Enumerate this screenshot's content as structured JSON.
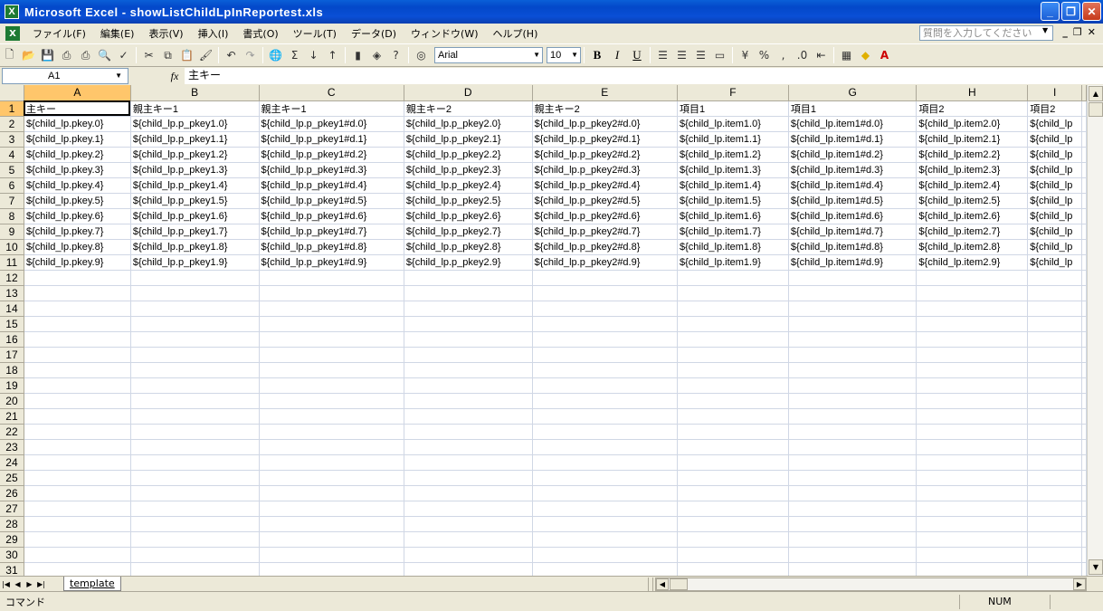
{
  "window": {
    "title": "Microsoft Excel - showListChildLpInReportest.xls",
    "app_icon": "X"
  },
  "menu": {
    "items": [
      "ファイル(F)",
      "編集(E)",
      "表示(V)",
      "挿入(I)",
      "書式(O)",
      "ツール(T)",
      "データ(D)",
      "ウィンドウ(W)",
      "ヘルプ(H)"
    ],
    "help_placeholder": "質問を入力してください"
  },
  "toolbar": {
    "font_name": "Arial",
    "font_size": "10",
    "bold": "B",
    "italic": "I",
    "underline": "U"
  },
  "formula_bar": {
    "cell_ref": "A1",
    "fx": "fx",
    "content": "主キー"
  },
  "sheet": {
    "columns": [
      "A",
      "B",
      "C",
      "D",
      "E",
      "F",
      "G",
      "H",
      "I"
    ],
    "active_column": "A",
    "active_row": 1,
    "row_count": 31,
    "header_row": [
      "主キー",
      "親主キー1",
      "親主キー1",
      "親主キー2",
      "親主キー2",
      "項目1",
      "項目1",
      "項目2",
      "項目2"
    ],
    "data_rows": [
      [
        "${child_lp.pkey.0}",
        "${child_lp.p_pkey1.0}",
        "${child_lp.p_pkey1#d.0}",
        "${child_lp.p_pkey2.0}",
        "${child_lp.p_pkey2#d.0}",
        "${child_lp.item1.0}",
        "${child_lp.item1#d.0}",
        "${child_lp.item2.0}",
        "${child_lp"
      ],
      [
        "${child_lp.pkey.1}",
        "${child_lp.p_pkey1.1}",
        "${child_lp.p_pkey1#d.1}",
        "${child_lp.p_pkey2.1}",
        "${child_lp.p_pkey2#d.1}",
        "${child_lp.item1.1}",
        "${child_lp.item1#d.1}",
        "${child_lp.item2.1}",
        "${child_lp"
      ],
      [
        "${child_lp.pkey.2}",
        "${child_lp.p_pkey1.2}",
        "${child_lp.p_pkey1#d.2}",
        "${child_lp.p_pkey2.2}",
        "${child_lp.p_pkey2#d.2}",
        "${child_lp.item1.2}",
        "${child_lp.item1#d.2}",
        "${child_lp.item2.2}",
        "${child_lp"
      ],
      [
        "${child_lp.pkey.3}",
        "${child_lp.p_pkey1.3}",
        "${child_lp.p_pkey1#d.3}",
        "${child_lp.p_pkey2.3}",
        "${child_lp.p_pkey2#d.3}",
        "${child_lp.item1.3}",
        "${child_lp.item1#d.3}",
        "${child_lp.item2.3}",
        "${child_lp"
      ],
      [
        "${child_lp.pkey.4}",
        "${child_lp.p_pkey1.4}",
        "${child_lp.p_pkey1#d.4}",
        "${child_lp.p_pkey2.4}",
        "${child_lp.p_pkey2#d.4}",
        "${child_lp.item1.4}",
        "${child_lp.item1#d.4}",
        "${child_lp.item2.4}",
        "${child_lp"
      ],
      [
        "${child_lp.pkey.5}",
        "${child_lp.p_pkey1.5}",
        "${child_lp.p_pkey1#d.5}",
        "${child_lp.p_pkey2.5}",
        "${child_lp.p_pkey2#d.5}",
        "${child_lp.item1.5}",
        "${child_lp.item1#d.5}",
        "${child_lp.item2.5}",
        "${child_lp"
      ],
      [
        "${child_lp.pkey.6}",
        "${child_lp.p_pkey1.6}",
        "${child_lp.p_pkey1#d.6}",
        "${child_lp.p_pkey2.6}",
        "${child_lp.p_pkey2#d.6}",
        "${child_lp.item1.6}",
        "${child_lp.item1#d.6}",
        "${child_lp.item2.6}",
        "${child_lp"
      ],
      [
        "${child_lp.pkey.7}",
        "${child_lp.p_pkey1.7}",
        "${child_lp.p_pkey1#d.7}",
        "${child_lp.p_pkey2.7}",
        "${child_lp.p_pkey2#d.7}",
        "${child_lp.item1.7}",
        "${child_lp.item1#d.7}",
        "${child_lp.item2.7}",
        "${child_lp"
      ],
      [
        "${child_lp.pkey.8}",
        "${child_lp.p_pkey1.8}",
        "${child_lp.p_pkey1#d.8}",
        "${child_lp.p_pkey2.8}",
        "${child_lp.p_pkey2#d.8}",
        "${child_lp.item1.8}",
        "${child_lp.item1#d.8}",
        "${child_lp.item2.8}",
        "${child_lp"
      ],
      [
        "${child_lp.pkey.9}",
        "${child_lp.p_pkey1.9}",
        "${child_lp.p_pkey1#d.9}",
        "${child_lp.p_pkey2.9}",
        "${child_lp.p_pkey2#d.9}",
        "${child_lp.item1.9}",
        "${child_lp.item1#d.9}",
        "${child_lp.item2.9}",
        "${child_lp"
      ]
    ],
    "tab_name": "template"
  },
  "status": {
    "mode": "コマンド",
    "num": "NUM"
  },
  "colors": {
    "title_bar": "#0a4fd6",
    "chrome": "#ece9d8",
    "active_header": "#ffc66b",
    "gridline": "#d0d7e5"
  }
}
